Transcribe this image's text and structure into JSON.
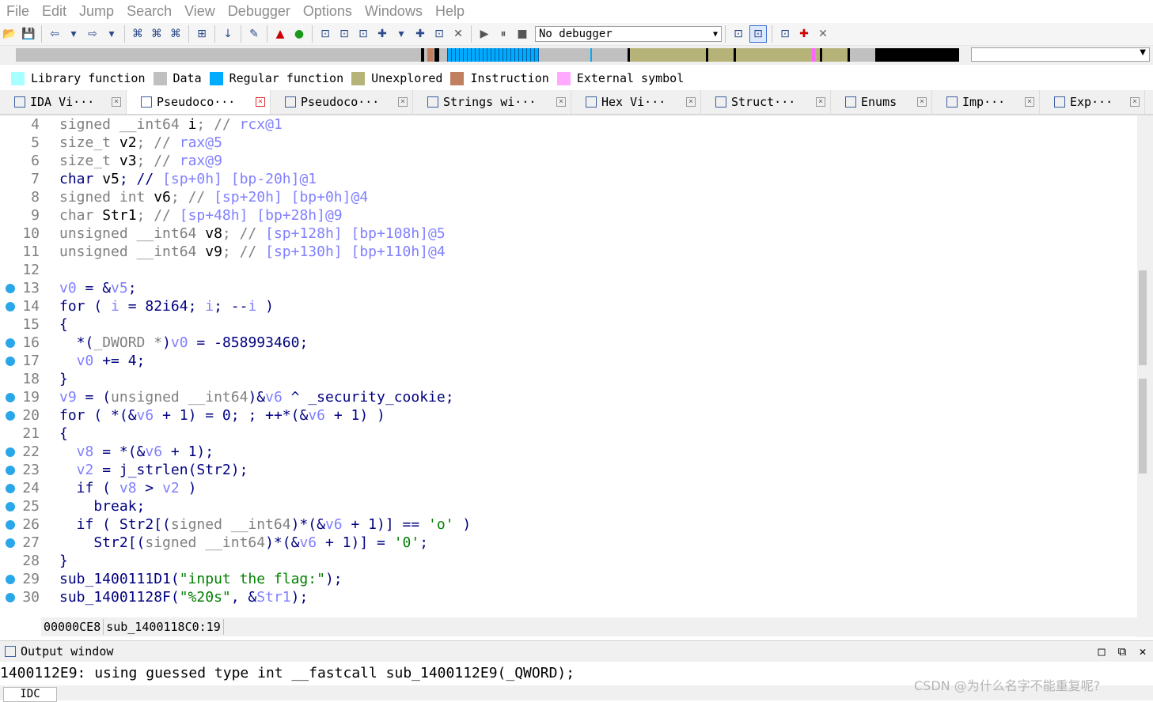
{
  "menu": [
    "File",
    "Edit",
    "Jump",
    "Search",
    "View",
    "Debugger",
    "Options",
    "Windows",
    "Help"
  ],
  "toolbar": {
    "debugger_select": "No debugger"
  },
  "legend": [
    {
      "label": "Library function",
      "color": "#a8ffff"
    },
    {
      "label": "Data",
      "color": "#c0c0c0"
    },
    {
      "label": "Regular function",
      "color": "#00aaff"
    },
    {
      "label": "Unexplored",
      "color": "#b5b378"
    },
    {
      "label": "Instruction",
      "color": "#c08060"
    },
    {
      "label": "External symbol",
      "color": "#ffaaff"
    }
  ],
  "tabs": [
    {
      "label": "IDA Vi···",
      "icon": "ida-view-icon",
      "active": false
    },
    {
      "label": "Pseudoco···",
      "icon": "pseudocode-icon",
      "active": true
    },
    {
      "label": "Pseudoco···",
      "icon": "pseudocode-icon",
      "active": false
    },
    {
      "label": "Strings wi···",
      "icon": "strings-icon",
      "active": false
    },
    {
      "label": "Hex Vi···",
      "icon": "hex-view-icon",
      "active": false
    },
    {
      "label": "Struct···",
      "icon": "structures-icon",
      "active": false
    },
    {
      "label": "Enums",
      "icon": "enums-icon",
      "active": false
    },
    {
      "label": "Imp···",
      "icon": "imports-icon",
      "active": false
    },
    {
      "label": "Exp···",
      "icon": "exports-icon",
      "active": false
    }
  ],
  "code": [
    {
      "n": "4",
      "bp": false,
      "t": [
        [
          "g",
          "signed __int64 "
        ],
        [
          "b",
          "i"
        ],
        [
          "g",
          "; // "
        ],
        [
          "v",
          "rcx@1"
        ]
      ]
    },
    {
      "n": "5",
      "bp": false,
      "t": [
        [
          "g",
          "size_t "
        ],
        [
          "b",
          "v2"
        ],
        [
          "g",
          "; // "
        ],
        [
          "v",
          "rax@5"
        ]
      ]
    },
    {
      "n": "6",
      "bp": false,
      "t": [
        [
          "g",
          "size_t "
        ],
        [
          "b",
          "v3"
        ],
        [
          "g",
          "; // "
        ],
        [
          "v",
          "rax@9"
        ]
      ]
    },
    {
      "n": "7",
      "bp": false,
      "t": [
        [
          "k",
          "char "
        ],
        [
          "b",
          "v5"
        ],
        [
          "k",
          "; // "
        ],
        [
          "v",
          "[sp+0h] [bp-20h]@1"
        ]
      ]
    },
    {
      "n": "8",
      "bp": false,
      "t": [
        [
          "g",
          "signed int "
        ],
        [
          "b",
          "v6"
        ],
        [
          "g",
          "; // "
        ],
        [
          "v",
          "[sp+20h] [bp+0h]@4"
        ]
      ]
    },
    {
      "n": "9",
      "bp": false,
      "t": [
        [
          "g",
          "char "
        ],
        [
          "b",
          "Str1"
        ],
        [
          "g",
          "; // "
        ],
        [
          "v",
          "[sp+48h] [bp+28h]@9"
        ]
      ]
    },
    {
      "n": "10",
      "bp": false,
      "t": [
        [
          "g",
          "unsigned __int64 "
        ],
        [
          "b",
          "v8"
        ],
        [
          "g",
          "; // "
        ],
        [
          "v",
          "[sp+128h] [bp+108h]@5"
        ]
      ]
    },
    {
      "n": "11",
      "bp": false,
      "t": [
        [
          "g",
          "unsigned __int64 "
        ],
        [
          "b",
          "v9"
        ],
        [
          "g",
          "; // "
        ],
        [
          "v",
          "[sp+130h] [bp+110h]@4"
        ]
      ]
    },
    {
      "n": "12",
      "bp": false,
      "t": []
    },
    {
      "n": "13",
      "bp": true,
      "t": [
        [
          "v",
          "v0"
        ],
        [
          "k",
          " = &"
        ],
        [
          "v",
          "v5"
        ],
        [
          "k",
          ";"
        ]
      ]
    },
    {
      "n": "14",
      "bp": true,
      "t": [
        [
          "k",
          "for ( "
        ],
        [
          "v",
          "i"
        ],
        [
          "k",
          " = 82i64; "
        ],
        [
          "v",
          "i"
        ],
        [
          "k",
          "; --"
        ],
        [
          "v",
          "i"
        ],
        [
          "k",
          " )"
        ]
      ]
    },
    {
      "n": "15",
      "bp": false,
      "t": [
        [
          "k",
          "{"
        ]
      ]
    },
    {
      "n": "16",
      "bp": true,
      "t": [
        [
          "k",
          "  *("
        ],
        [
          "g",
          "_DWORD *"
        ],
        [
          "k",
          ")"
        ],
        [
          "v",
          "v0"
        ],
        [
          "k",
          " = -858993460;"
        ]
      ]
    },
    {
      "n": "17",
      "bp": true,
      "t": [
        [
          "v",
          "  v0"
        ],
        [
          "k",
          " += 4;"
        ]
      ]
    },
    {
      "n": "18",
      "bp": false,
      "t": [
        [
          "k",
          "}"
        ]
      ]
    },
    {
      "n": "19",
      "bp": true,
      "t": [
        [
          "v",
          "v9"
        ],
        [
          "k",
          " = ("
        ],
        [
          "g",
          "unsigned __int64"
        ],
        [
          "k",
          ")&"
        ],
        [
          "v",
          "v6"
        ],
        [
          "k",
          " ^ _security_cookie;"
        ]
      ]
    },
    {
      "n": "20",
      "bp": true,
      "t": [
        [
          "k",
          "for ( *(&"
        ],
        [
          "v",
          "v6"
        ],
        [
          "k",
          " + 1) = 0; ; ++*(&"
        ],
        [
          "v",
          "v6"
        ],
        [
          "k",
          " + 1) )"
        ]
      ]
    },
    {
      "n": "21",
      "bp": false,
      "t": [
        [
          "k",
          "{"
        ]
      ]
    },
    {
      "n": "22",
      "bp": true,
      "t": [
        [
          "v",
          "  v8"
        ],
        [
          "k",
          " = *(&"
        ],
        [
          "v",
          "v6"
        ],
        [
          "k",
          " + 1);"
        ]
      ]
    },
    {
      "n": "23",
      "bp": true,
      "t": [
        [
          "v",
          "  v2"
        ],
        [
          "k",
          " = j_strlen(Str2);"
        ]
      ]
    },
    {
      "n": "24",
      "bp": true,
      "t": [
        [
          "k",
          "  if ( "
        ],
        [
          "v",
          "v8"
        ],
        [
          "k",
          " > "
        ],
        [
          "v",
          "v2"
        ],
        [
          "k",
          " )"
        ]
      ]
    },
    {
      "n": "25",
      "bp": true,
      "t": [
        [
          "k",
          "    break;"
        ]
      ]
    },
    {
      "n": "26",
      "bp": true,
      "t": [
        [
          "k",
          "  if ( Str2[("
        ],
        [
          "g",
          "signed __int64"
        ],
        [
          "k",
          ")*(&"
        ],
        [
          "v",
          "v6"
        ],
        [
          "k",
          " + 1)] == "
        ],
        [
          "s",
          "'o'"
        ],
        [
          "k",
          " )"
        ]
      ]
    },
    {
      "n": "27",
      "bp": true,
      "t": [
        [
          "k",
          "    Str2[("
        ],
        [
          "g",
          "signed __int64"
        ],
        [
          "k",
          ")*(&"
        ],
        [
          "v",
          "v6"
        ],
        [
          "k",
          " + 1)] = "
        ],
        [
          "s",
          "'0'"
        ],
        [
          "k",
          ";"
        ]
      ]
    },
    {
      "n": "28",
      "bp": false,
      "t": [
        [
          "k",
          "}"
        ]
      ]
    },
    {
      "n": "29",
      "bp": true,
      "t": [
        [
          "k",
          "sub_1400111D1("
        ],
        [
          "s",
          "\"input the flag:\""
        ],
        [
          "k",
          ");"
        ]
      ]
    },
    {
      "n": "30",
      "bp": true,
      "t": [
        [
          "k",
          "sub_14001128F("
        ],
        [
          "s",
          "\"%20s\""
        ],
        [
          "k",
          ", &"
        ],
        [
          "v",
          "Str1"
        ],
        [
          "k",
          ");"
        ]
      ]
    }
  ],
  "status": {
    "address": "00000CE8",
    "location": "sub_1400118C0:19"
  },
  "output": {
    "title": "Output window",
    "text": "1400112E9: using guessed type int __fastcall sub_1400112E9(_QWORD);",
    "tab": "IDC"
  },
  "watermark": "CSDN @为什么名字不能重复呢?"
}
